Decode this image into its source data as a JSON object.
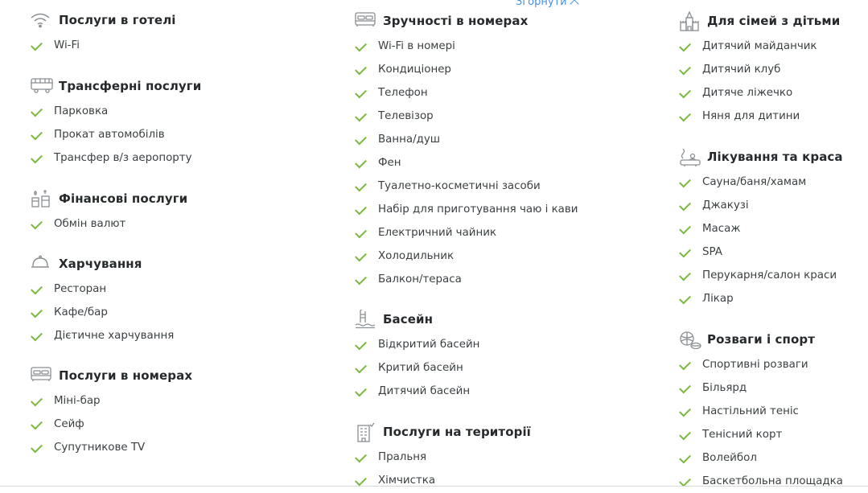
{
  "collapse_label": "Згорнути",
  "colors": {
    "check": "#7ab83d",
    "link": "#4a8fd6",
    "icon": "#8a8f93"
  },
  "columns": [
    {
      "sections": [
        {
          "icon": "wifi-icon",
          "title": "Послуги в готелі",
          "items": [
            "Wi-Fi"
          ]
        },
        {
          "icon": "bus-icon",
          "title": "Трансферні послуги",
          "items": [
            "Парковка",
            "Прокат автомобілів",
            "Трансфер в/з аеропорту"
          ]
        },
        {
          "icon": "money-icon",
          "title": "Фінансові послуги",
          "items": [
            "Обмін валют"
          ]
        },
        {
          "icon": "cloche-icon",
          "title": "Харчування",
          "items": [
            "Ресторан",
            "Кафе/бар",
            "Дієтичне харчування"
          ]
        },
        {
          "icon": "bed-icon",
          "title": "Послуги в номерах",
          "items": [
            "Міні-бар",
            "Сейф",
            "Супутникове TV"
          ]
        }
      ]
    },
    {
      "sections": [
        {
          "icon": "bed-icon",
          "title": "Зручності в номерах",
          "items": [
            "Wi-Fi в номері",
            "Кондиціонер",
            "Телефон",
            "Телевізор",
            "Ванна/душ",
            "Фен",
            "Туалетно-косметичні засоби",
            "Набір для приготування чаю і кави",
            "Електричний чайник",
            "Холодильник",
            "Балкон/тераса"
          ]
        },
        {
          "icon": "pool-ladder-icon",
          "title": "Басейн",
          "items": [
            "Відкритий басейн",
            "Критий басейн",
            "Дитячий басейн"
          ]
        },
        {
          "icon": "building-icon",
          "title": "Послуги на території",
          "items": [
            "Пральня",
            "Хімчистка"
          ]
        }
      ]
    },
    {
      "sections": [
        {
          "icon": "castle-icon",
          "title": "Для сімей з дітьми",
          "items": [
            "Дитячий майданчик",
            "Дитячий клуб",
            "Дитяче ліжечко",
            "Няня для дитини"
          ]
        },
        {
          "icon": "spa-icon",
          "title": "Лікування та краса",
          "items": [
            "Сауна/баня/хамам",
            "Джакузі",
            "Масаж",
            "SPA",
            "Перукарня/салон краси",
            "Лікар"
          ]
        },
        {
          "icon": "sport-icon",
          "title": "Розваги і спорт",
          "items": [
            "Спортивні розваги",
            "Більярд",
            "Настільний теніс",
            "Тенісний корт",
            "Волейбол",
            "Баскетбольна площадка"
          ]
        }
      ]
    }
  ]
}
